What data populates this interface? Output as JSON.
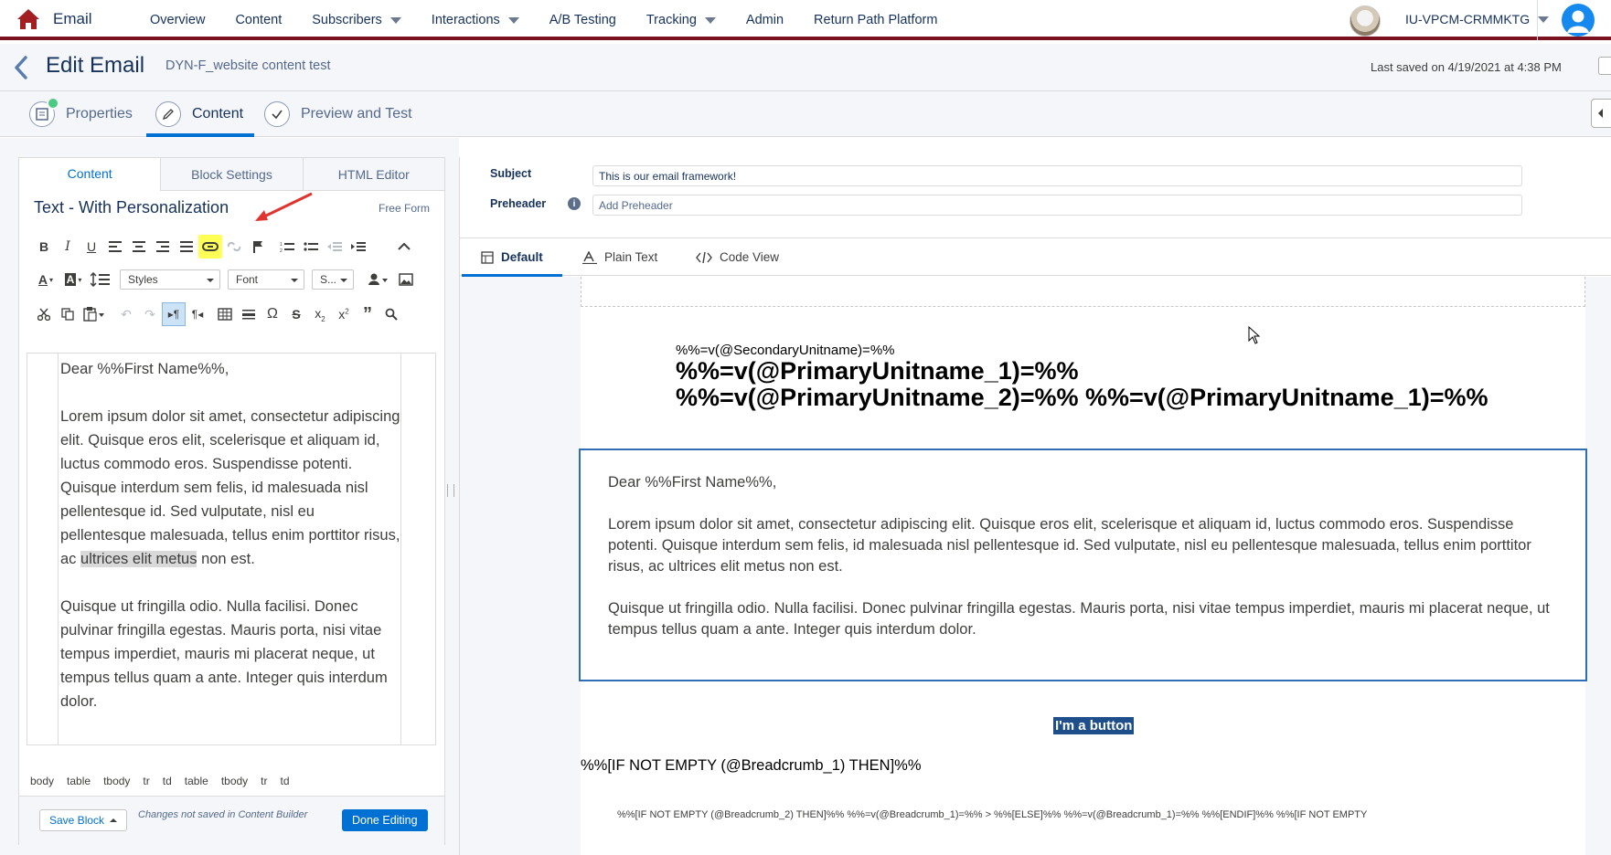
{
  "colors": {
    "accent": "#0070d2",
    "nav_border": "#7a1220",
    "highlight": "#ffff55",
    "button_bg": "#1e4f8a",
    "success": "#4bca81"
  },
  "topnav": {
    "app_name": "Email",
    "items": [
      {
        "label": "Overview",
        "dropdown": false
      },
      {
        "label": "Content",
        "dropdown": false
      },
      {
        "label": "Subscribers",
        "dropdown": true
      },
      {
        "label": "Interactions",
        "dropdown": true
      },
      {
        "label": "A/B Testing",
        "dropdown": false
      },
      {
        "label": "Tracking",
        "dropdown": true
      },
      {
        "label": "Admin",
        "dropdown": false
      },
      {
        "label": "Return Path Platform",
        "dropdown": false
      }
    ],
    "org_name": "IU-VPCM-CRMMKTG"
  },
  "header": {
    "title": "Edit Email",
    "email_name": "DYN-F_website content test",
    "last_saved": "Last saved on 4/19/2021 at 4:38 PM"
  },
  "steps": [
    {
      "label": "Properties",
      "icon": "properties-icon",
      "completed": true
    },
    {
      "label": "Content",
      "icon": "pencil-icon",
      "active": true
    },
    {
      "label": "Preview and Test",
      "icon": "checkmark-icon"
    }
  ],
  "left_panel": {
    "tabs": [
      "Content",
      "Block Settings",
      "HTML Editor"
    ],
    "active_tab": "Content",
    "block_title": "Text - With Personalization",
    "block_mode": "Free Form",
    "toolbar": {
      "styles": "Styles",
      "font": "Font",
      "size": "S..."
    },
    "editor": {
      "greeting": "Dear %%First Name%%,",
      "para1_before": "Lorem ipsum dolor sit amet, consectetur adipiscing elit. Quisque eros elit, scelerisque et aliquam id, luctus commodo eros. Suspendisse potenti. Quisque interdum sem felis, id malesuada nisl pellentesque id. Sed vulputate, nisl eu pellentesque malesuada, tellus enim porttitor risus, ac ",
      "para1_selected": "ultrices elit metus",
      "para1_after": " non est.",
      "para2": "Quisque ut fringilla odio. Nulla facilisi. Donec pulvinar fringilla egestas. Mauris porta, nisi vitae tempus imperdiet, mauris mi placerat neque, ut tempus tellus quam a ante. Integer quis interdum dolor."
    },
    "element_path": [
      "body",
      "table",
      "tbody",
      "tr",
      "td",
      "table",
      "tbody",
      "tr",
      "td"
    ],
    "footer": {
      "save_block": "Save Block",
      "unsaved_note": "Changes not saved in Content Builder",
      "done": "Done Editing"
    }
  },
  "right_panel": {
    "subject_label": "Subject",
    "subject_value": "This is our email framework!",
    "preheader_label": "Preheader",
    "preheader_placeholder": "Add Preheader",
    "view_tabs": [
      "Default",
      "Plain Text",
      "Code View"
    ],
    "active_view": "Default",
    "email": {
      "secondary_unit": "%%=v(@SecondaryUnitname)=%%",
      "primary_1": "%%=v(@PrimaryUnitname_1)=%%",
      "primary_2": "%%=v(@PrimaryUnitname_2)=%% %%=v(@PrimaryUnitname_1)=%%",
      "greeting": "Dear %%First Name%%,",
      "para1": "Lorem ipsum dolor sit amet, consectetur adipiscing elit. Quisque eros elit, scelerisque et aliquam id, luctus commodo eros. Suspendisse potenti. Quisque interdum sem felis, id malesuada nisl pellentesque id. Sed vulputate, nisl eu pellentesque malesuada, tellus enim porttitor risus, ac ultrices elit metus non est.",
      "para2": "Quisque ut fringilla odio. Nulla facilisi. Donec pulvinar fringilla egestas. Mauris porta, nisi vitae tempus imperdiet, mauris mi placerat neque, ut tempus tellus quam a ante. Integer quis interdum dolor.",
      "button_label": "I'm a button",
      "if_breadcrumb": "%%[IF NOT EMPTY (@Breadcrumb_1) THEN]%%",
      "cutoff_text": "%%[IF NOT EMPTY (@Breadcrumb_2) THEN]%% %%=v(@Breadcrumb_1)=%% > %%[ELSE]%% %%=v(@Breadcrumb_1)=%% %%[ENDIF]%% %%[IF NOT EMPTY"
    }
  }
}
